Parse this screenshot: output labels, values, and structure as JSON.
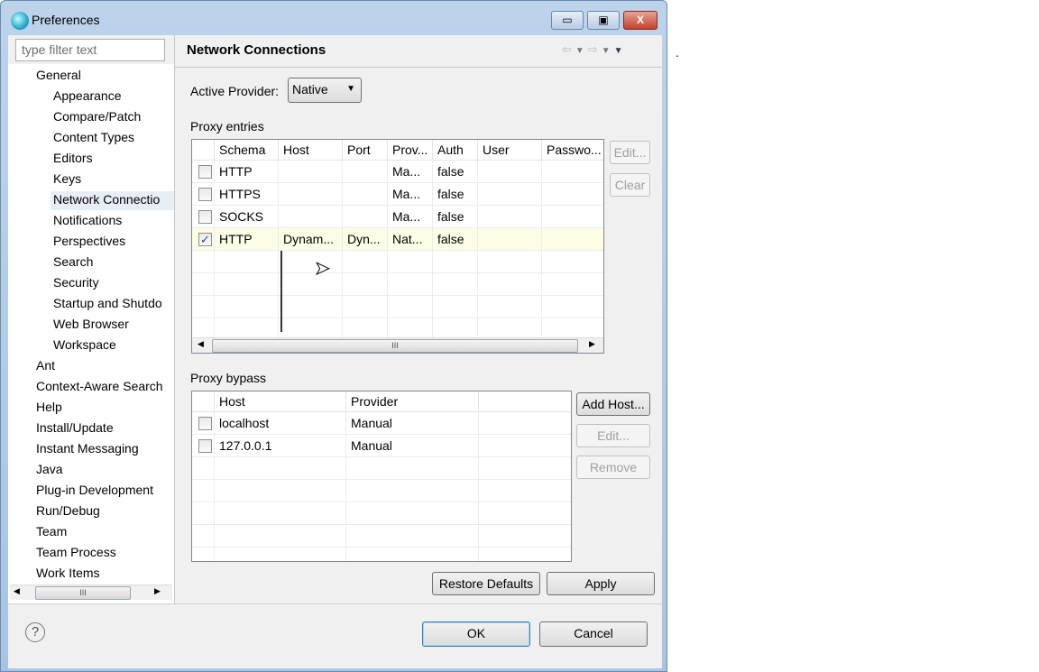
{
  "window": {
    "title": "Preferences",
    "minimize": "▭",
    "maximize": "▣",
    "close": "X"
  },
  "sidebar": {
    "filter_placeholder": "type filter text",
    "items": [
      {
        "label": "General",
        "level": 0
      },
      {
        "label": "Appearance",
        "level": 1
      },
      {
        "label": "Compare/Patch",
        "level": 1
      },
      {
        "label": "Content Types",
        "level": 1
      },
      {
        "label": "Editors",
        "level": 1
      },
      {
        "label": "Keys",
        "level": 1
      },
      {
        "label": "Network Connectio",
        "level": 1,
        "selected": true
      },
      {
        "label": "Notifications",
        "level": 1
      },
      {
        "label": "Perspectives",
        "level": 1
      },
      {
        "label": "Search",
        "level": 1
      },
      {
        "label": "Security",
        "level": 1
      },
      {
        "label": "Startup and Shutdo",
        "level": 1
      },
      {
        "label": "Web Browser",
        "level": 1
      },
      {
        "label": "Workspace",
        "level": 1
      },
      {
        "label": "Ant",
        "level": 0
      },
      {
        "label": "Context-Aware Search",
        "level": 0
      },
      {
        "label": "Help",
        "level": 0
      },
      {
        "label": "Install/Update",
        "level": 0
      },
      {
        "label": "Instant Messaging",
        "level": 0
      },
      {
        "label": "Java",
        "level": 0
      },
      {
        "label": "Plug-in Development",
        "level": 0
      },
      {
        "label": "Run/Debug",
        "level": 0
      },
      {
        "label": "Team",
        "level": 0
      },
      {
        "label": "Team Process",
        "level": 0
      },
      {
        "label": "Work Items",
        "level": 0
      }
    ],
    "scroll_thumb": "III"
  },
  "page": {
    "title": "Network Connections",
    "active_provider_label": "Active Provider:",
    "active_provider_value": "Native"
  },
  "proxy_entries": {
    "label": "Proxy entries",
    "columns": [
      "",
      "Schema",
      "Host",
      "Port",
      "Prov...",
      "Auth",
      "User",
      "Passwo..."
    ],
    "rows": [
      {
        "checked": false,
        "cells": [
          "HTTP",
          "",
          "",
          "Ma...",
          "false",
          "",
          ""
        ]
      },
      {
        "checked": false,
        "cells": [
          "HTTPS",
          "",
          "",
          "Ma...",
          "false",
          "",
          ""
        ]
      },
      {
        "checked": false,
        "cells": [
          "SOCKS",
          "",
          "",
          "Ma...",
          "false",
          "",
          ""
        ]
      },
      {
        "checked": true,
        "cells": [
          "HTTP",
          "Dynam...",
          "Dyn...",
          "Nat...",
          "false",
          "",
          ""
        ]
      }
    ],
    "edit": "Edit...",
    "clear": "Clear",
    "scroll_thumb": "III"
  },
  "proxy_bypass": {
    "label": "Proxy bypass",
    "columns": [
      "",
      "Host",
      "Provider",
      ""
    ],
    "rows": [
      {
        "checked": false,
        "cells": [
          "localhost",
          "Manual",
          ""
        ]
      },
      {
        "checked": false,
        "cells": [
          "127.0.0.1",
          "Manual",
          ""
        ]
      }
    ],
    "add_host": "Add Host...",
    "edit": "Edit...",
    "remove": "Remove"
  },
  "buttons": {
    "restore_defaults": "Restore Defaults",
    "apply": "Apply",
    "ok": "OK",
    "cancel": "Cancel",
    "help": "?"
  },
  "stray_text": "."
}
